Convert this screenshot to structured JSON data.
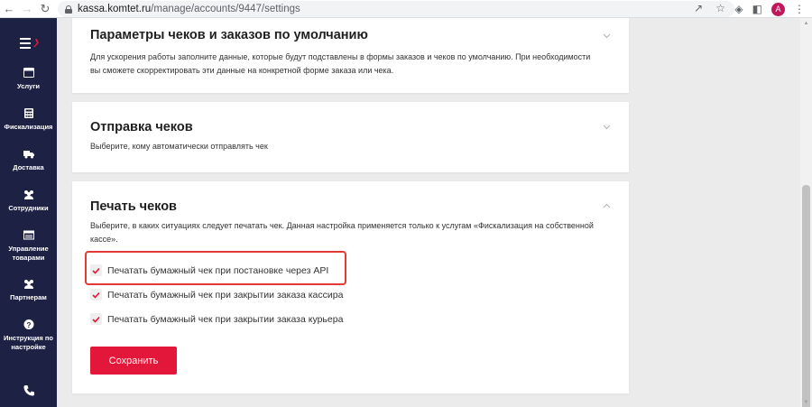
{
  "browser": {
    "url_domain": "kassa.komtet.ru",
    "url_path": "/manage/accounts/9447/settings",
    "profile_initial": "A",
    "icons": [
      "back-icon",
      "forward-icon",
      "reload-icon",
      "lock-icon",
      "share-icon",
      "star-icon",
      "extensions-icon",
      "sidepanel-icon",
      "more-icon"
    ]
  },
  "sidebar": {
    "items": [
      {
        "label": "Услуги",
        "icon": "services-icon"
      },
      {
        "label": "Фискализация",
        "icon": "calculator-icon"
      },
      {
        "label": "Доставка",
        "icon": "truck-icon"
      },
      {
        "label": "Сотрудники",
        "icon": "users-icon"
      },
      {
        "label": "Управление товарами",
        "icon": "goods-icon"
      },
      {
        "label": "Партнерам",
        "icon": "partners-icon"
      },
      {
        "label": "Инструкция по настройке",
        "icon": "help-icon"
      },
      {
        "label": "",
        "icon": "phone-icon"
      }
    ]
  },
  "sections": {
    "defaults": {
      "title": "Параметры чеков и заказов по умолчанию",
      "description": "Для ускорения работы заполните данные, которые будут подставлены в формы заказов и чеков по умолчанию. При необходимости вы сможете скорректировать эти данные на конкретной форме заказа или чека."
    },
    "sending": {
      "title": "Отправка чеков",
      "description": "Выберите, кому автоматически отправлять чек"
    },
    "printing": {
      "title": "Печать чеков",
      "description": "Выберите, в каких ситуациях следует печатать чек. Данная настройка применяется только к услугам «Фискализация на собственной кассе».",
      "options": [
        {
          "label": "Печатать бумажный чек при постановке через API",
          "checked": true
        },
        {
          "label": "Печатать бумажный чек при закрытии заказа кассира",
          "checked": true
        },
        {
          "label": "Печатать бумажный чек при закрытии заказа курьера",
          "checked": true
        }
      ],
      "save_label": "Сохранить"
    }
  },
  "colors": {
    "accent": "#e3173a",
    "sidebar_bg": "#1d2244",
    "highlight": "#e53935"
  }
}
